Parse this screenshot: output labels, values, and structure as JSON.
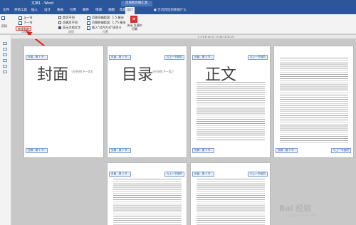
{
  "window": {
    "app_title": "文档1 - Word",
    "context_tab": "页眉和页脚工具"
  },
  "tabs": [
    "文件",
    "开始工具",
    "插入",
    "设计",
    "布局",
    "引用",
    "邮件",
    "审阅",
    "视图",
    "帮助",
    "设计"
  ],
  "tell_me": "告诉我您想要做什么",
  "ribbon": {
    "nav_items": [
      "上一节",
      "下一节"
    ],
    "link_prev": "链接到前一条页眉",
    "checkboxes": [
      {
        "label": "首页不同",
        "checked": false
      },
      {
        "label": "奇偶页不同",
        "checked": false
      },
      {
        "label": "显示文档文字",
        "checked": true
      }
    ],
    "positions": [
      {
        "label": "页眉顶端距离:",
        "value": "1.5 厘米"
      },
      {
        "label": "页脚底端距离:",
        "value": "1.75 厘米"
      },
      {
        "label": "插入\"对齐方式\"选项卡",
        "value": ""
      }
    ],
    "groups": [
      "导航",
      "选项",
      "位置"
    ],
    "close_label": "关闭\n页眉和页脚",
    "left_label": "页码"
  },
  "ruler": {
    "label": "2 4 6 8 10 12 14 16 18 20 22"
  },
  "pages": [
    {
      "title": "封面",
      "subtitle": "（分节符(下一页)）",
      "tag_top": "页眉 - 第 1 节 -",
      "tag_bottom": "页脚 - 第 1 节 -",
      "tag_same": ""
    },
    {
      "title": "目录",
      "subtitle": "（分节符(下一页)）",
      "tag_top": "页眉 - 第 2 节 -",
      "tag_bottom": "页脚 - 第 2 节 -",
      "tag_same": "与上一节相同"
    },
    {
      "title": "正文",
      "subtitle": "",
      "tag_top": "页眉 - 第 3 节 -",
      "tag_bottom": "页脚 - 第 3 节 -",
      "tag_same": "与上一节相同"
    },
    {
      "title": "",
      "subtitle": "",
      "tag_top": "",
      "tag_bottom": "页脚 - 第 3 节 -",
      "tag_same": "与上一节相同"
    },
    {
      "title": "",
      "subtitle": "",
      "tag_top": "页眉 - 第 3 节 -",
      "tag_bottom": "",
      "tag_same": "与上一节相同"
    },
    {
      "title": "",
      "subtitle": "",
      "tag_top": "页眉 - 第 3 节 -",
      "tag_bottom": "",
      "tag_same": "与上一节相同"
    }
  ],
  "watermark": {
    "main": "Bai 经验",
    "sub": "jingyan.baidu.com"
  },
  "colors": {
    "accent": "#2b579a",
    "annotation": "#e02020"
  }
}
